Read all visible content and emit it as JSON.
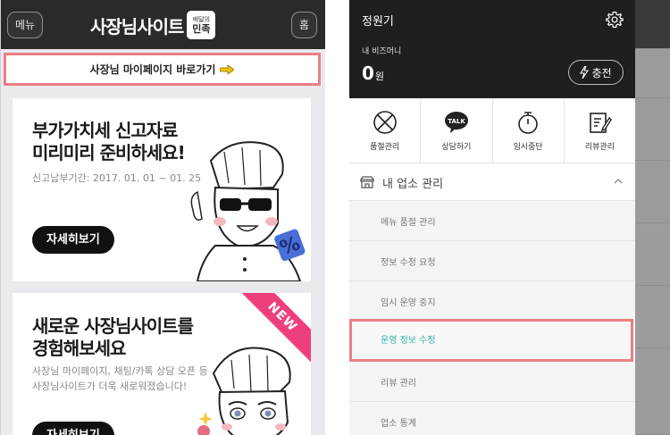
{
  "left_app": {
    "menu_label": "메뉴",
    "home_label": "홈",
    "brand_text": "사장님사이트",
    "brand_badge_top": "배달의",
    "brand_badge_bottom": "민족",
    "mypage_link": "사장님 마이페이지 바로가기",
    "card1": {
      "title_line1": "부가가치세 신고자료",
      "title_line2": "미리미리 준비하세요!",
      "sub": "신고납부기간: 2017. 01. 01 ~ 01. 25",
      "button": "자세히보기"
    },
    "card2": {
      "ribbon": "NEW",
      "title_line1": "새로운 사장님사이트를",
      "title_line2": "경험해보세요",
      "sub_line1": "사장님 마이페이지, 채팅/카톡 상담 오픈 등",
      "sub_line2": "사장님사이트가 더욱 새로워졌습니다!",
      "button": "자세히보기"
    }
  },
  "right_app": {
    "user_name": "정원기",
    "money_label": "내 비즈머니",
    "money_value": "0",
    "money_unit": "원",
    "charge_label": "충전",
    "quick_menu": [
      {
        "icon": "soldout-icon",
        "label": "품절관리"
      },
      {
        "icon": "talk-icon",
        "label": "상담하기",
        "icon_text": "TALK"
      },
      {
        "icon": "timer-icon",
        "label": "임시중단"
      },
      {
        "icon": "review-icon",
        "label": "리뷰관리"
      }
    ],
    "section_label": "내 업소 관리",
    "sub_items": [
      "메뉴 품절 관리",
      "정보 수정 요청",
      "임시 운영 중지",
      "운영 정보 수정",
      "리뷰 관리",
      "업소 통계"
    ],
    "active_sub_index": 3
  },
  "colors": {
    "highlight_border": "#ea7f86",
    "active_text": "#2bb5a7",
    "dark_header": "#1f1f1f",
    "new_ribbon": "#ee3f7d"
  }
}
